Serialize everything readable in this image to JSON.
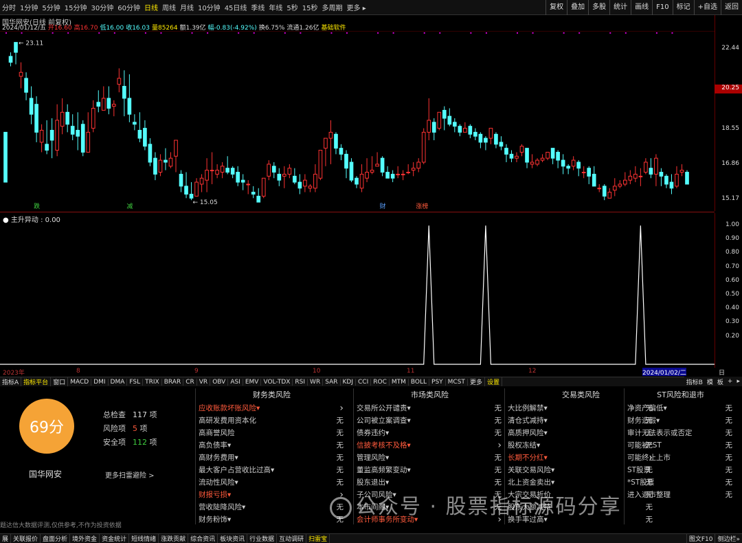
{
  "timeframes": [
    "分时",
    "1分钟",
    "5分钟",
    "15分钟",
    "30分钟",
    "60分钟",
    "日线",
    "周线",
    "月线",
    "10分钟",
    "45日线",
    "季线",
    "年线",
    "5秒",
    "15秒",
    "多周期",
    "更多 ▸"
  ],
  "active_timeframe": "日线",
  "right_buttons": [
    "复权",
    "叠加",
    "多股",
    "统计",
    "画线",
    "F10",
    "标记",
    "+自选",
    "返回"
  ],
  "stock_title": "国华网安(日线 前复权)",
  "quote": {
    "date": "2024/01/12/五",
    "open": "开16.60",
    "high": "高16.70",
    "low": "低16.00",
    "close": "收16.03",
    "volume": "量85264",
    "amount": "额1.39亿",
    "change": "幅-0.83(-4.92%)",
    "turnover": "换6.75%",
    "float": "流通1.26亿",
    "source": "基础软件"
  },
  "price_ticks": [
    "22.44",
    "18.55",
    "16.86",
    "15.17"
  ],
  "current_price": "20.25",
  "annotations": {
    "high": "23.11",
    "low": "15.05"
  },
  "event_labels": [
    "跌",
    "减",
    "财",
    "涨榜"
  ],
  "indicator_title": "主升异动 : 0.00",
  "ind_ticks": [
    "1.00",
    "0.90",
    "0.80",
    "0.70",
    "0.60",
    "0.50",
    "0.40",
    "0.30",
    "0.20"
  ],
  "date_labels": [
    "2023年",
    "8",
    "9",
    "10",
    "11",
    "12"
  ],
  "date_hl": "2024/01/02/二",
  "right_axis_label": "日线",
  "indicator_tabs": [
    "指标A",
    "指标平台",
    "窗口",
    "MACD",
    "DMI",
    "DMA",
    "FSL",
    "TRIX",
    "BRAR",
    "CR",
    "VR",
    "OBV",
    "ASI",
    "EMV",
    "VOL-TDX",
    "RSI",
    "WR",
    "SAR",
    "KDJ",
    "CCI",
    "ROC",
    "MTM",
    "BOLL",
    "PSY",
    "MCST",
    "更多",
    "设置"
  ],
  "indicator_right": [
    "指标B",
    "模",
    "板",
    "+",
    "▸"
  ],
  "score": "69分",
  "stock_name": "国华网安",
  "summary": {
    "total_label": "总检查",
    "total": "117",
    "total_unit": "项",
    "risk_label": "风险项",
    "risk": "5",
    "risk_unit": "项",
    "safe_label": "安全项",
    "safe": "112",
    "safe_unit": "项"
  },
  "more_scan": "更多扫雷避险 >",
  "disclaimer": "题达信大数据评测,仅供参考,不作为投资依据",
  "columns": [
    {
      "title": "财务类风险",
      "rows": [
        [
          "应收账款坏账风险▾",
          "",
          "1"
        ],
        [
          "高研发费用资本化",
          "无",
          "0"
        ],
        [
          "高商誉风险",
          "无",
          "0"
        ],
        [
          "高负债率▾",
          "无",
          "0"
        ],
        [
          "高财务费用▾",
          "无",
          "0"
        ],
        [
          "最大客户占营收比过高▾",
          "无",
          "0"
        ],
        [
          "流动性风险▾",
          "无",
          "0"
        ],
        [
          "财报亏损▾",
          "",
          "1"
        ],
        [
          "营收陡降风险▾",
          "无",
          "0"
        ],
        [
          "财务粉饰▾",
          "无",
          "0"
        ]
      ]
    },
    {
      "title": "市场类风险",
      "rows": [
        [
          "交易所公开谴责▾",
          "无",
          "0"
        ],
        [
          "公司被立案调查▾",
          "无",
          "0"
        ],
        [
          "债券违约▾",
          "无",
          "0"
        ],
        [
          "信披考核不及格▾",
          "",
          "1"
        ],
        [
          "管理风险▾",
          "无",
          "0"
        ],
        [
          "董监高频繁变动▾",
          "无",
          "0"
        ],
        [
          "股东退出▾",
          "无",
          "0"
        ],
        [
          "子公司风险▾",
          "无",
          "0"
        ],
        [
          "本市间阁▾",
          "无",
          "0"
        ],
        [
          "会计师事务所变动▾",
          "",
          "1"
        ]
      ]
    },
    {
      "title": "交易类风险",
      "rows": [
        [
          "大比例解禁▾",
          "无",
          "0"
        ],
        [
          "清仓式减持▾",
          "无",
          "0"
        ],
        [
          "高质押风险▾",
          "无",
          "0"
        ],
        [
          "股权冻结▾",
          "无",
          "0"
        ],
        [
          "长期不分红▾",
          "",
          "1"
        ],
        [
          "关联交易风险▾",
          "无",
          "0"
        ],
        [
          "北上资金卖出▾",
          "无",
          "0"
        ],
        [
          "大宗交易折价",
          "无",
          "0"
        ],
        [
          "股东大额减持",
          "无",
          "0"
        ],
        [
          "换手率过高▾",
          "无",
          "0"
        ]
      ]
    },
    {
      "title": "ST风险和退市",
      "rows": [
        [
          "净资产偏低▾",
          "无",
          "0"
        ],
        [
          "财务造假▾",
          "无",
          "0"
        ],
        [
          "审计无法表示或否定",
          "无",
          "0"
        ],
        [
          "可能被*ST",
          "无",
          "0"
        ],
        [
          "可能终止上市",
          "无",
          "0"
        ],
        [
          "ST股票",
          "无",
          "0"
        ],
        [
          "*ST股票",
          "无",
          "0"
        ],
        [
          "进入退市整理",
          "无",
          "0"
        ]
      ]
    }
  ],
  "bottom_tabs": [
    "展",
    "关联报价",
    "盘面分析",
    "境外资金",
    "资金统计",
    "短线情绪",
    "涨跌贡献",
    "综合资讯",
    "板块资讯",
    "行业数据",
    "互动调研",
    "扫雷宝"
  ],
  "bottom_right": [
    "图文F10",
    "侧边栏»"
  ],
  "watermark": "公众号 · 股票指标源码分享",
  "colors": {
    "up": "#ff3333",
    "down": "#54ffff",
    "risk": "#ff5a3c",
    "active": "#ffea00",
    "score": "#f5a336"
  },
  "chart_data": {
    "type": "candlestick",
    "ylim": [
      15.0,
      23.5
    ],
    "ohlc": [
      [
        18.6,
        16.1,
        18.6,
        16.1
      ],
      [
        22.4,
        22.1,
        22.6,
        21.9
      ],
      [
        23.1,
        22.6,
        23.1,
        22.0
      ],
      [
        21.4,
        21.6,
        22.1,
        20.8
      ],
      [
        21.3,
        20.6,
        21.6,
        20.2
      ],
      [
        20.3,
        19.5,
        20.9,
        19.0
      ],
      [
        20.0,
        18.6,
        20.4,
        18.1
      ],
      [
        18.1,
        18.7,
        19.0,
        17.6
      ],
      [
        18.0,
        17.7,
        19.2,
        17.5
      ],
      [
        18.7,
        18.2,
        19.3,
        17.3
      ],
      [
        17.7,
        19.2,
        20.0,
        17.4
      ],
      [
        18.9,
        19.6,
        20.3,
        18.5
      ],
      [
        19.6,
        19.0,
        20.0,
        18.6
      ],
      [
        18.9,
        18.5,
        19.5,
        18.2
      ],
      [
        18.7,
        18.4,
        19.6,
        17.7
      ],
      [
        19.0,
        17.6,
        19.2,
        17.4
      ],
      [
        17.6,
        18.6,
        19.6,
        17.6
      ],
      [
        18.8,
        19.8,
        20.2,
        18.6
      ],
      [
        20.1,
        19.9,
        20.7,
        19.6
      ],
      [
        19.7,
        20.3,
        20.9,
        19.7
      ],
      [
        20.3,
        19.8,
        20.9,
        19.5
      ],
      [
        19.9,
        20.0,
        20.2,
        19.4
      ],
      [
        21.0,
        21.3,
        21.8,
        20.6
      ],
      [
        20.9,
        20.3,
        21.7,
        19.4
      ],
      [
        20.3,
        19.5,
        21.5,
        19.1
      ],
      [
        19.1,
        19.0,
        19.5,
        18.7
      ],
      [
        18.7,
        18.3,
        19.6,
        18.1
      ],
      [
        18.8,
        17.9,
        19.2,
        17.7
      ],
      [
        18.0,
        17.1,
        18.3,
        16.9
      ],
      [
        17.3,
        16.5,
        17.6,
        16.2
      ],
      [
        16.6,
        17.2,
        17.5,
        16.4
      ],
      [
        17.2,
        17.1,
        17.8,
        16.7
      ],
      [
        16.9,
        17.3,
        17.6,
        16.8
      ],
      [
        17.4,
        18.2,
        18.2,
        16.6
      ],
      [
        16.5,
        15.9,
        16.7,
        15.6
      ],
      [
        15.9,
        15.5,
        16.6,
        15.3
      ],
      [
        15.5,
        15.3,
        16.1,
        15.2
      ],
      [
        15.4,
        16.1,
        16.3,
        15.4
      ],
      [
        16.0,
        16.3,
        16.5,
        15.6
      ],
      [
        16.2,
        16.7,
        17.3,
        15.6
      ],
      [
        16.7,
        16.7,
        17.6,
        16.0
      ],
      [
        16.5,
        16.7,
        17.0,
        16.3
      ],
      [
        16.6,
        16.9,
        17.1,
        16.3
      ],
      [
        16.8,
        16.6,
        17.4,
        16.5
      ],
      [
        16.8,
        16.5,
        16.9,
        16.3
      ],
      [
        16.6,
        16.1,
        16.9,
        15.9
      ],
      [
        16.2,
        16.1,
        16.5,
        15.7
      ],
      [
        16.0,
        16.0,
        16.2,
        15.5
      ],
      [
        15.6,
        15.5,
        15.9,
        15.3
      ],
      [
        15.4,
        15.1,
        15.8,
        15.1
      ],
      [
        15.4,
        16.3,
        16.3,
        15.3
      ],
      [
        16.4,
        17.0,
        17.2,
        16.2
      ],
      [
        16.9,
        16.6,
        17.1,
        16.3
      ],
      [
        16.5,
        16.2,
        16.8,
        15.9
      ],
      [
        16.4,
        16.5,
        16.9,
        15.8
      ],
      [
        16.5,
        16.8,
        17.0,
        16.3
      ],
      [
        16.4,
        16.1,
        16.8,
        16.0
      ],
      [
        16.1,
        15.8,
        16.5,
        15.5
      ],
      [
        15.9,
        16.2,
        16.5,
        15.6
      ],
      [
        15.8,
        15.9,
        16.0,
        15.6
      ],
      [
        15.8,
        16.5,
        17.0,
        15.6
      ],
      [
        16.3,
        17.7,
        17.7,
        16.2
      ],
      [
        17.8,
        18.3,
        18.3,
        16.9
      ],
      [
        18.3,
        18.6,
        19.2,
        17.0
      ],
      [
        18.5,
        17.8,
        18.6,
        17.5
      ],
      [
        17.8,
        17.5,
        18.0,
        17.2
      ],
      [
        17.5,
        16.8,
        17.7,
        16.3
      ],
      [
        17.1,
        16.2,
        17.3,
        16.1
      ],
      [
        16.3,
        16.0,
        16.4,
        15.8
      ],
      [
        15.8,
        16.5,
        17.0,
        15.6
      ],
      [
        16.3,
        16.6,
        17.3,
        16.1
      ],
      [
        16.6,
        16.7,
        17.4,
        16.5
      ],
      [
        16.9,
        17.0,
        17.6,
        16.9
      ],
      [
        17.3,
        16.6,
        17.4,
        16.4
      ],
      [
        16.6,
        16.3,
        16.9,
        16.3
      ],
      [
        16.5,
        16.3,
        16.7,
        16.1
      ],
      [
        16.5,
        16.5,
        16.9,
        16.3
      ],
      [
        16.5,
        16.5,
        16.7,
        16.2
      ],
      [
        16.6,
        16.6,
        17.0,
        16.5
      ],
      [
        16.7,
        16.8,
        17.1,
        16.4
      ],
      [
        16.8,
        17.1,
        17.3,
        16.6
      ],
      [
        17.1,
        18.6,
        18.8,
        17.0
      ],
      [
        18.6,
        19.2,
        20.3,
        18.2
      ],
      [
        19.1,
        18.6,
        19.3,
        18.2
      ],
      [
        18.8,
        19.6,
        19.6,
        18.7
      ],
      [
        19.7,
        19.3,
        19.9,
        18.7
      ],
      [
        19.4,
        19.0,
        19.8,
        18.9
      ],
      [
        19.1,
        18.9,
        19.3,
        18.6
      ],
      [
        18.9,
        18.6,
        19.0,
        18.4
      ],
      [
        18.6,
        18.8,
        19.1,
        18.6
      ],
      [
        18.9,
        18.5,
        19.0,
        18.3
      ],
      [
        18.6,
        18.4,
        18.8,
        18.2
      ],
      [
        18.5,
        18.1,
        18.6,
        17.8
      ],
      [
        18.3,
        18.1,
        18.4,
        17.7
      ],
      [
        18.3,
        18.8,
        18.8,
        18.0
      ],
      [
        18.5,
        18.0,
        18.6,
        17.8
      ],
      [
        18.1,
        17.9,
        18.4,
        17.7
      ],
      [
        17.8,
        17.5,
        18.0,
        17.1
      ],
      [
        17.5,
        17.3,
        17.7,
        17.1
      ],
      [
        17.3,
        17.4,
        17.6,
        17.1
      ],
      [
        17.6,
        17.9,
        18.0,
        17.4
      ],
      [
        17.8,
        17.1,
        17.8,
        16.8
      ],
      [
        17.0,
        17.1,
        17.5,
        16.8
      ],
      [
        17.0,
        17.2,
        17.3,
        16.9
      ],
      [
        17.2,
        17.3,
        17.5,
        17.1
      ],
      [
        17.3,
        17.6,
        17.6,
        17.2
      ],
      [
        17.8,
        17.3,
        17.8,
        17.0
      ],
      [
        17.6,
        17.2,
        17.7,
        16.8
      ],
      [
        17.2,
        16.9,
        17.5,
        16.5
      ],
      [
        16.9,
        16.8,
        17.0,
        16.5
      ],
      [
        16.9,
        17.2,
        17.4,
        16.7
      ],
      [
        17.1,
        16.8,
        17.2,
        16.4
      ],
      [
        16.6,
        16.6,
        16.9,
        16.3
      ],
      [
        16.8,
        16.4,
        16.9,
        16.0
      ],
      [
        16.5,
        15.9,
        16.9,
        15.9
      ],
      [
        15.8,
        15.8,
        16.0,
        15.6
      ],
      [
        15.9,
        15.4,
        16.0,
        15.2
      ],
      [
        15.3,
        15.6,
        15.8,
        15.3
      ],
      [
        15.7,
        15.9,
        16.3,
        15.4
      ],
      [
        15.9,
        16.0,
        16.2,
        15.8
      ],
      [
        16.0,
        16.2,
        16.6,
        15.9
      ],
      [
        16.2,
        16.4,
        16.7,
        16.0
      ],
      [
        16.3,
        16.5,
        16.9,
        16.1
      ],
      [
        16.4,
        16.4,
        16.8,
        15.9
      ],
      [
        16.6,
        17.1,
        17.3,
        16.5
      ],
      [
        16.8,
        16.5,
        17.3,
        16.3
      ],
      [
        16.5,
        17.3,
        17.5,
        15.9
      ],
      [
        16.6,
        16.4,
        16.8,
        15.9
      ],
      [
        16.4,
        16.0,
        16.5,
        15.8
      ],
      [
        16.1,
        15.8,
        16.5,
        15.5
      ],
      [
        15.9,
        16.5,
        16.9,
        15.8
      ],
      [
        16.6,
        16.7,
        17.0,
        16.4
      ],
      [
        16.6,
        16.0,
        16.7,
        16.0
      ]
    ],
    "indicator": {
      "name": "主升异动",
      "value": "0.00",
      "ylim": [
        0,
        1.05
      ],
      "spike_indices": [
        82,
        93,
        123
      ],
      "spike_value": 1.0
    }
  }
}
